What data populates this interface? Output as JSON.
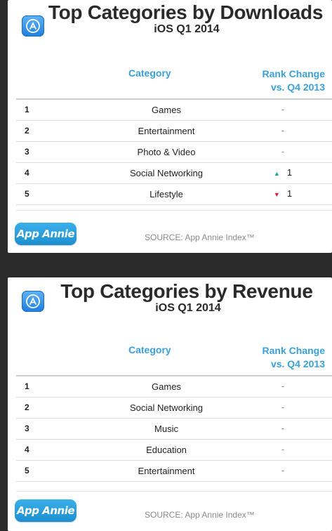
{
  "downloads": {
    "title": "Top Categories by Downloads",
    "subtitle": "iOS Q1 2014",
    "header_category": "Category",
    "header_rank_change_line1": "Rank Change",
    "header_rank_change_line2": "vs. Q4 2013",
    "rows": [
      {
        "rank": "1",
        "category": "Games",
        "change": "-",
        "direction": ""
      },
      {
        "rank": "2",
        "category": "Entertainment",
        "change": "-",
        "direction": ""
      },
      {
        "rank": "3",
        "category": "Photo & Video",
        "change": "-",
        "direction": ""
      },
      {
        "rank": "4",
        "category": "Social Networking",
        "change": "1",
        "direction": "up"
      },
      {
        "rank": "5",
        "category": "Lifestyle",
        "change": "1",
        "direction": "down"
      }
    ],
    "logo_text": "App Annie",
    "source": "SOURCE: App Annie Index™"
  },
  "revenue": {
    "title": "Top Categories by Revenue",
    "subtitle": "iOS Q1 2014",
    "header_category": "Category",
    "header_rank_change_line1": "Rank Change",
    "header_rank_change_line2": "vs. Q4 2013",
    "rows": [
      {
        "rank": "1",
        "category": "Games",
        "change": "-",
        "direction": ""
      },
      {
        "rank": "2",
        "category": "Social Networking",
        "change": "-",
        "direction": ""
      },
      {
        "rank": "3",
        "category": "Music",
        "change": "-",
        "direction": ""
      },
      {
        "rank": "4",
        "category": "Education",
        "change": "-",
        "direction": ""
      },
      {
        "rank": "5",
        "category": "Entertainment",
        "change": "-",
        "direction": ""
      }
    ],
    "logo_text": "App Annie",
    "source": "SOURCE: App Annie Index™"
  },
  "icons": {
    "store": "app-store-icon",
    "up": "triangle-up-icon",
    "down": "triangle-down-icon"
  },
  "colors": {
    "accent": "#3aa0d8",
    "up": "#1aa89a",
    "down": "#d8202f",
    "background": "#2b2b2b"
  }
}
